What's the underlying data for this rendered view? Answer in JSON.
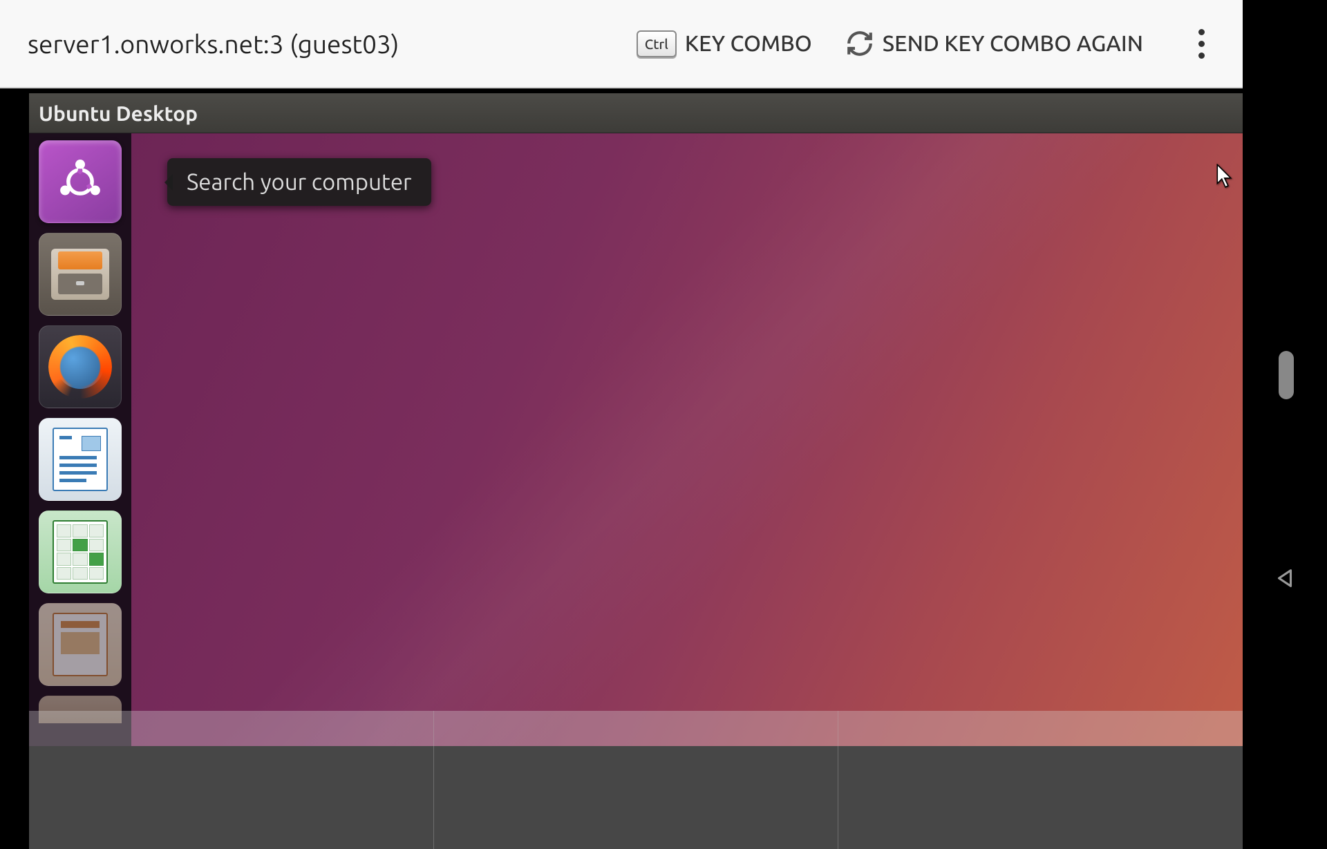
{
  "toolbar": {
    "server_label": "server1.onworks.net:3 (guest03)",
    "ctrl_key": "Ctrl",
    "key_combo_label": "KEY COMBO",
    "send_again_label": "SEND KEY COMBO AGAIN"
  },
  "window": {
    "title": "Ubuntu Desktop"
  },
  "tooltip": {
    "text": "Search your computer"
  },
  "launcher": {
    "items": [
      {
        "name": "dash",
        "label": "Search your computer"
      },
      {
        "name": "files",
        "label": "Files"
      },
      {
        "name": "firefox",
        "label": "Firefox Web Browser"
      },
      {
        "name": "writer",
        "label": "LibreOffice Writer"
      },
      {
        "name": "calc",
        "label": "LibreOffice Calc"
      },
      {
        "name": "impress",
        "label": "LibreOffice Impress"
      }
    ]
  },
  "colors": {
    "accent": "#b955c9",
    "toolbar_bg": "#f8f8f8",
    "titlebar_bg": "#3d3c38"
  }
}
